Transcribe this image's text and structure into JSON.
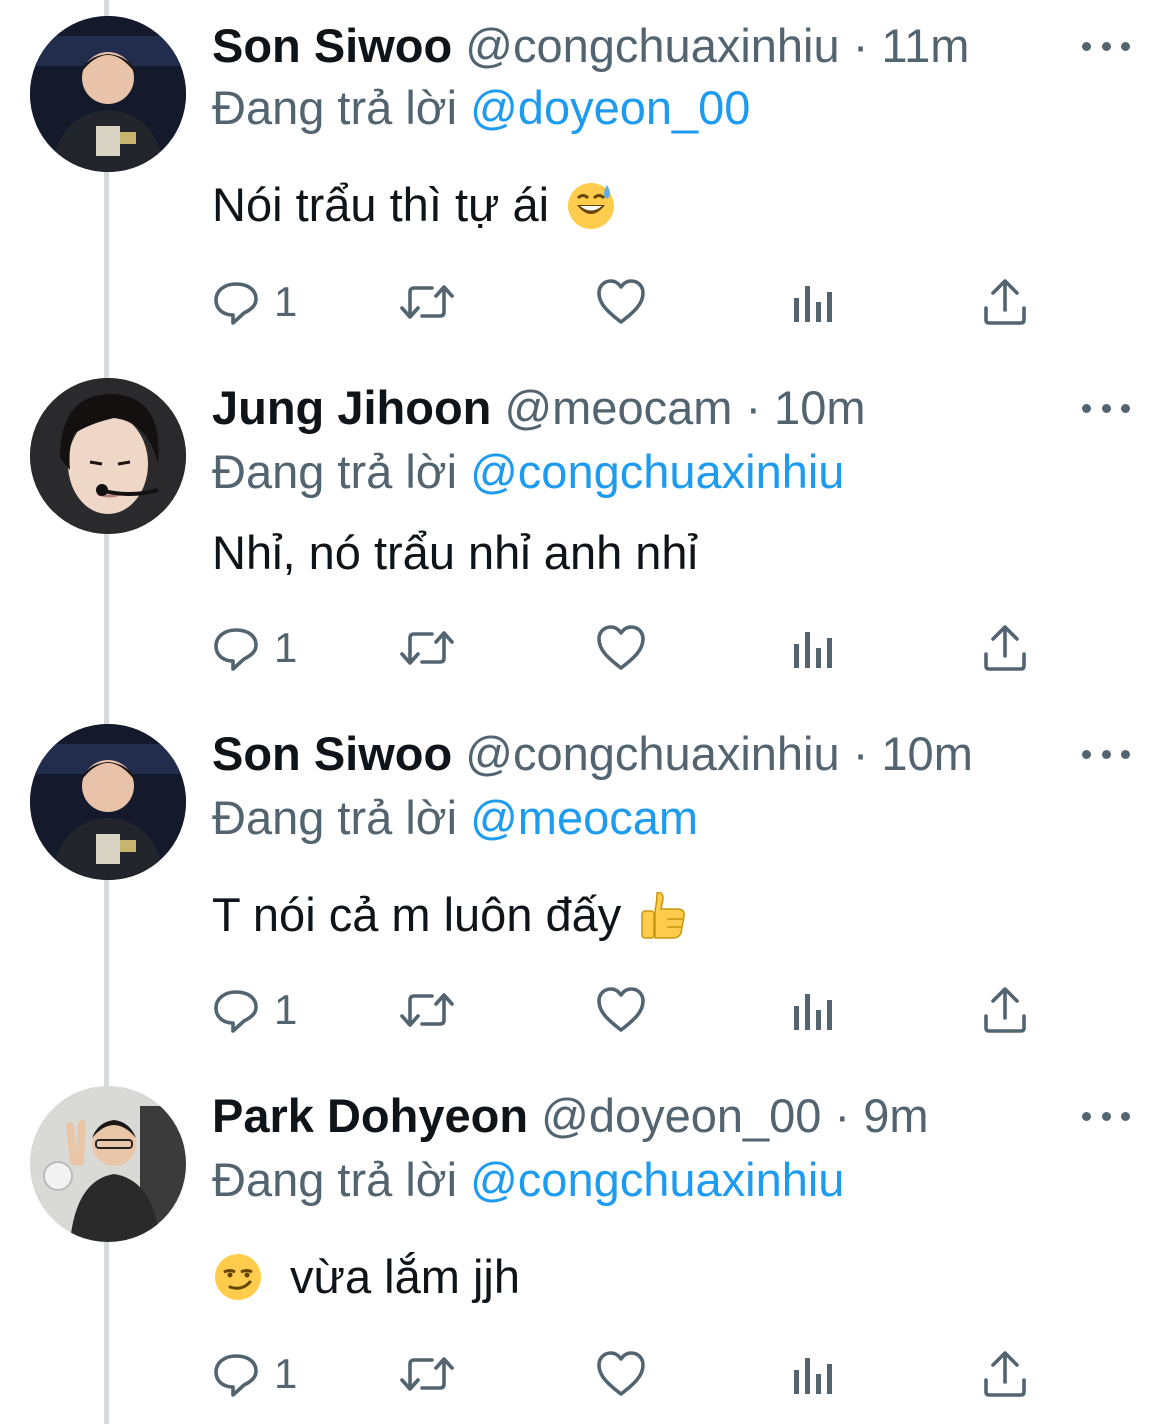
{
  "colors": {
    "name": "#0f1419",
    "muted": "#536471",
    "mention": "#1d9bf0",
    "thread_line": "#d6dadd"
  },
  "tweets": [
    {
      "avatar_icon": "player-avatar-son-siwoo",
      "name": "Son Siwoo",
      "handle": "@congchuaxinhiu",
      "separator": "·",
      "time": "11m",
      "reply_prefix": "Đang trả lời",
      "reply_to": "@doyeon_00",
      "text": "Nói trẩu thì tự ái",
      "emoji": "sweat-smile-emoji",
      "reply_count": "1"
    },
    {
      "avatar_icon": "player-avatar-jung-jihoon",
      "name": "Jung Jihoon",
      "handle": "@meocam",
      "separator": "·",
      "time": "10m",
      "reply_prefix": "Đang trả lời",
      "reply_to": "@congchuaxinhiu",
      "text": "Nhỉ, nó trẩu nhỉ anh nhỉ",
      "emoji": "",
      "reply_count": "1"
    },
    {
      "avatar_icon": "player-avatar-son-siwoo",
      "name": "Son Siwoo",
      "handle": "@congchuaxinhiu",
      "separator": "·",
      "time": "10m",
      "reply_prefix": "Đang trả lời",
      "reply_to": "@meocam",
      "text": "T nói cả m luôn đấy",
      "emoji": "thumbs-up-emoji",
      "reply_count": "1"
    },
    {
      "avatar_icon": "player-avatar-park-dohyeon",
      "name": "Park Dohyeon",
      "handle": "@doyeon_00",
      "separator": "·",
      "time": "9m",
      "reply_prefix": "Đang trả lời",
      "reply_to": "@congchuaxinhiu",
      "text": "vừa lắm jjh",
      "emoji": "smirk-emoji",
      "reply_count": "1"
    }
  ],
  "action_icons": [
    "reply-icon",
    "retweet-icon",
    "like-icon",
    "analytics-icon",
    "share-icon"
  ]
}
